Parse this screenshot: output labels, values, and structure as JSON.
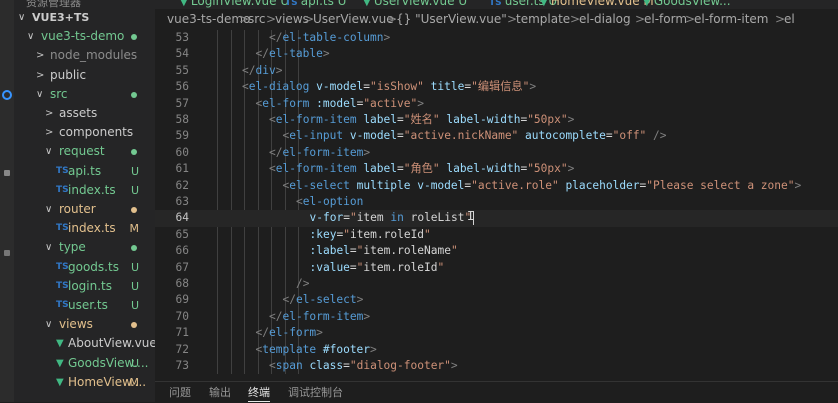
{
  "sidebar": {
    "header": "资源管理器",
    "rows": [
      {
        "chev": "∨",
        "name": "VUE3+TS",
        "indent": 0,
        "bold": true,
        "color": "#cccccc"
      },
      {
        "chev": "∨",
        "name": "vue3-ts-demo",
        "indent": 1,
        "dot": "#73c991",
        "color": "#73c991"
      },
      {
        "chev": ">",
        "name": "node_modules",
        "indent": 2,
        "color": "#8c8c8c"
      },
      {
        "chev": ">",
        "name": "public",
        "indent": 2,
        "color": "#cccccc"
      },
      {
        "chev": "∨",
        "name": "src",
        "indent": 2,
        "dot": "#73c991",
        "color": "#73c991"
      },
      {
        "chev": ">",
        "name": "assets",
        "indent": 3,
        "color": "#cccccc"
      },
      {
        "chev": ">",
        "name": "components",
        "indent": 3,
        "color": "#cccccc"
      },
      {
        "chev": "∨",
        "name": "request",
        "indent": 3,
        "dot": "#73c991",
        "color": "#73c991"
      },
      {
        "icon": "TS",
        "name": "api.ts",
        "indent": 4,
        "badge": "U",
        "badgeColor": "#73c991",
        "color": "#73c991"
      },
      {
        "icon": "TS",
        "name": "index.ts",
        "indent": 4,
        "badge": "U",
        "badgeColor": "#73c991",
        "color": "#73c991"
      },
      {
        "chev": "∨",
        "name": "router",
        "indent": 3,
        "dot": "#e2c08d",
        "color": "#e2c08d"
      },
      {
        "icon": "TS",
        "name": "index.ts",
        "indent": 4,
        "badge": "M",
        "badgeColor": "#e2c08d",
        "color": "#e2c08d"
      },
      {
        "chev": "∨",
        "name": "type",
        "indent": 3,
        "dot": "#73c991",
        "color": "#73c991"
      },
      {
        "icon": "TS",
        "name": "goods.ts",
        "indent": 4,
        "badge": "U",
        "badgeColor": "#73c991",
        "color": "#73c991"
      },
      {
        "icon": "TS",
        "name": "login.ts",
        "indent": 4,
        "badge": "U",
        "badgeColor": "#73c991",
        "color": "#73c991"
      },
      {
        "icon": "TS",
        "name": "user.ts",
        "indent": 4,
        "badge": "U",
        "badgeColor": "#73c991",
        "color": "#73c991"
      },
      {
        "chev": "∨",
        "name": "views",
        "indent": 3,
        "dot": "#e2c08d",
        "color": "#e2c08d"
      },
      {
        "icon": "V",
        "name": "AboutView.vue",
        "indent": 4,
        "color": "#cccccc"
      },
      {
        "icon": "V",
        "name": "GoodsView....",
        "indent": 4,
        "badge": "U",
        "badgeColor": "#73c991",
        "color": "#73c991"
      },
      {
        "icon": "V",
        "name": "HomeView....",
        "indent": 4,
        "badge": "M",
        "badgeColor": "#e2c08d",
        "color": "#e2c08d"
      }
    ]
  },
  "tabs": [
    {
      "icon": "V",
      "label": "LoginView.vue",
      "status": "U",
      "color": "#73c991"
    },
    {
      "icon": "TS",
      "label": "api.ts",
      "status": "U",
      "color": "#73c991"
    },
    {
      "icon": "V",
      "label": "UserView.vue",
      "status": "U",
      "color": "#73c991",
      "active": true
    },
    {
      "icon": "TS",
      "label": "user.ts",
      "status": "U",
      "color": "#73c991"
    },
    {
      "icon": "V",
      "label": "HomeView.vue",
      "status": "M",
      "color": "#e2c08d"
    },
    {
      "icon": "V",
      "label": "GoodsView...",
      "status": "",
      "color": "#73c991"
    }
  ],
  "breadcrumb": [
    "vue3-ts-demo",
    ">",
    "src",
    ">",
    "views",
    ">",
    "UserView.vue",
    ">",
    "{} \"UserView.vue\"",
    ">",
    "template",
    ">",
    "el-dialog",
    ">",
    "el-form",
    ">",
    "el-form-item",
    ">",
    "el"
  ],
  "code": {
    "active_line": 64,
    "lines": [
      {
        "n": "53",
        "indent": 4,
        "tokens": [
          [
            "t-punc",
            "</"
          ],
          [
            "t-tag",
            "el-table-column"
          ],
          [
            "t-punc",
            ">"
          ]
        ]
      },
      {
        "n": "54",
        "indent": 3,
        "tokens": [
          [
            "t-punc",
            "</"
          ],
          [
            "t-tag",
            "el-table"
          ],
          [
            "t-punc",
            ">"
          ]
        ]
      },
      {
        "n": "55",
        "indent": 2,
        "tokens": [
          [
            "t-punc",
            "</"
          ],
          [
            "t-tag",
            "div"
          ],
          [
            "t-punc",
            ">"
          ]
        ]
      },
      {
        "n": "56",
        "indent": 2,
        "tokens": [
          [
            "t-punc",
            "<"
          ],
          [
            "t-tag",
            "el-dialog "
          ],
          [
            "t-attr",
            "v-model"
          ],
          [
            "t-plain",
            "="
          ],
          [
            "t-str",
            "\"isShow\" "
          ],
          [
            "t-attr",
            "title"
          ],
          [
            "t-plain",
            "="
          ],
          [
            "t-str",
            "\"编辑信息\""
          ],
          [
            "t-punc",
            ">"
          ]
        ]
      },
      {
        "n": "57",
        "indent": 3,
        "tokens": [
          [
            "t-punc",
            "<"
          ],
          [
            "t-tag",
            "el-form "
          ],
          [
            "t-attr",
            ":model"
          ],
          [
            "t-plain",
            "="
          ],
          [
            "t-str",
            "\"active\""
          ],
          [
            "t-punc",
            ">"
          ]
        ]
      },
      {
        "n": "58",
        "indent": 4,
        "tokens": [
          [
            "t-punc",
            "<"
          ],
          [
            "t-tag",
            "el-form-item "
          ],
          [
            "t-attr",
            "label"
          ],
          [
            "t-plain",
            "="
          ],
          [
            "t-str",
            "\"姓名\" "
          ],
          [
            "t-attr",
            "label-width"
          ],
          [
            "t-plain",
            "="
          ],
          [
            "t-str",
            "\"50px\""
          ],
          [
            "t-punc",
            ">"
          ]
        ]
      },
      {
        "n": "59",
        "indent": 5,
        "tokens": [
          [
            "t-punc",
            "<"
          ],
          [
            "t-tag",
            "el-input "
          ],
          [
            "t-attr",
            "v-model"
          ],
          [
            "t-plain",
            "="
          ],
          [
            "t-str",
            "\"active.nickName\" "
          ],
          [
            "t-attr",
            "autocomplete"
          ],
          [
            "t-plain",
            "="
          ],
          [
            "t-str",
            "\"off\" "
          ],
          [
            "t-punc",
            "/>"
          ]
        ]
      },
      {
        "n": "60",
        "indent": 4,
        "tokens": [
          [
            "t-punc",
            "</"
          ],
          [
            "t-tag",
            "el-form-item"
          ],
          [
            "t-punc",
            ">"
          ]
        ]
      },
      {
        "n": "61",
        "indent": 4,
        "tokens": [
          [
            "t-punc",
            "<"
          ],
          [
            "t-tag",
            "el-form-item "
          ],
          [
            "t-attr",
            "label"
          ],
          [
            "t-plain",
            "="
          ],
          [
            "t-str",
            "\"角色\" "
          ],
          [
            "t-attr",
            "label-width"
          ],
          [
            "t-plain",
            "="
          ],
          [
            "t-str",
            "\"50px\""
          ],
          [
            "t-punc",
            ">"
          ]
        ]
      },
      {
        "n": "62",
        "indent": 5,
        "tokens": [
          [
            "t-punc",
            "<"
          ],
          [
            "t-tag",
            "el-select "
          ],
          [
            "t-attr",
            "multiple v-model"
          ],
          [
            "t-plain",
            "="
          ],
          [
            "t-str",
            "\"active.role\" "
          ],
          [
            "t-attr",
            "placeholder"
          ],
          [
            "t-plain",
            "="
          ],
          [
            "t-str",
            "\"Please select a zone\""
          ],
          [
            "t-punc",
            ">"
          ]
        ]
      },
      {
        "n": "63",
        "indent": 6,
        "tokens": [
          [
            "t-punc",
            "<"
          ],
          [
            "t-tag",
            "el-option"
          ]
        ]
      },
      {
        "n": "64",
        "indent": 7,
        "tokens": [
          [
            "t-attr",
            "v-for"
          ],
          [
            "t-plain",
            "="
          ],
          [
            "t-str",
            "\""
          ],
          [
            "t-plain",
            "item "
          ],
          [
            "t-tag",
            "in "
          ],
          [
            "t-plain",
            "roleList"
          ],
          [
            "t-str",
            "\""
          ]
        ]
      },
      {
        "n": "65",
        "indent": 7,
        "tokens": [
          [
            "t-attr",
            ":key"
          ],
          [
            "t-plain",
            "="
          ],
          [
            "t-str",
            "\""
          ],
          [
            "t-plain",
            "item.roleId"
          ],
          [
            "t-str",
            "\""
          ]
        ]
      },
      {
        "n": "66",
        "indent": 7,
        "tokens": [
          [
            "t-attr",
            ":label"
          ],
          [
            "t-plain",
            "="
          ],
          [
            "t-str",
            "\""
          ],
          [
            "t-plain",
            "item.roleName"
          ],
          [
            "t-str",
            "\""
          ]
        ]
      },
      {
        "n": "67",
        "indent": 7,
        "tokens": [
          [
            "t-attr",
            ":value"
          ],
          [
            "t-plain",
            "="
          ],
          [
            "t-str",
            "\""
          ],
          [
            "t-plain",
            "item.roleId"
          ],
          [
            "t-str",
            "\""
          ]
        ]
      },
      {
        "n": "68",
        "indent": 6,
        "tokens": [
          [
            "t-punc",
            "/>"
          ]
        ]
      },
      {
        "n": "69",
        "indent": 5,
        "tokens": [
          [
            "t-punc",
            "</"
          ],
          [
            "t-tag",
            "el-select"
          ],
          [
            "t-punc",
            ">"
          ]
        ]
      },
      {
        "n": "70",
        "indent": 4,
        "tokens": [
          [
            "t-punc",
            "</"
          ],
          [
            "t-tag",
            "el-form-item"
          ],
          [
            "t-punc",
            ">"
          ]
        ]
      },
      {
        "n": "71",
        "indent": 3,
        "tokens": [
          [
            "t-punc",
            "</"
          ],
          [
            "t-tag",
            "el-form"
          ],
          [
            "t-punc",
            ">"
          ]
        ]
      },
      {
        "n": "72",
        "indent": 3,
        "tokens": [
          [
            "t-punc",
            "<"
          ],
          [
            "t-tag",
            "template "
          ],
          [
            "t-attr",
            "#footer"
          ],
          [
            "t-punc",
            ">"
          ]
        ]
      },
      {
        "n": "73",
        "indent": 4,
        "tokens": [
          [
            "t-punc",
            "<"
          ],
          [
            "t-tag",
            "span "
          ],
          [
            "t-attr",
            "class"
          ],
          [
            "t-plain",
            "="
          ],
          [
            "t-str",
            "\"dialog-footer\""
          ],
          [
            "t-punc",
            ">"
          ]
        ]
      }
    ]
  },
  "panel": {
    "tabs": [
      "问题",
      "输出",
      "终端",
      "调试控制台"
    ],
    "active": "终端"
  }
}
